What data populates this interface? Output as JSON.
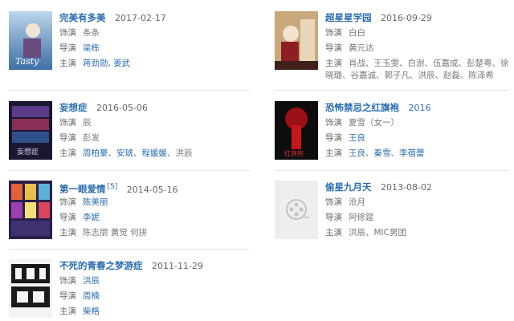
{
  "labels": {
    "role": "饰演",
    "director": "导演",
    "cast": "主演"
  },
  "movies": [
    {
      "title": "完美有多美",
      "date": "2017-02-17",
      "role": "条条",
      "director": "梁栋",
      "cast": [
        "蒋劲勋",
        "姜武"
      ]
    },
    {
      "title": "超星星学园",
      "date": "2016-09-29",
      "role": "白白",
      "director": "黄元达",
      "cast": [
        "肖战",
        "王玉雯",
        "白澍",
        "伍嘉成",
        "彭楚粤",
        "徐晓璐",
        "谷嘉诚",
        "郭子凡",
        "洪辰",
        "赵磊",
        "陈泽希"
      ]
    },
    {
      "title": "妄想症",
      "date": "2016-05-06",
      "role": "辰",
      "director": "彭发",
      "cast": [
        "周柏豪",
        "安琥",
        "程媛媛",
        "洪辰"
      ]
    },
    {
      "title": "恐怖禁忌之红旗袍",
      "date": "2016",
      "role": "夏雪（女一）",
      "director": "王良",
      "cast": [
        "王良",
        "秦雪",
        "李蓓蕾"
      ]
    },
    {
      "title": "第一眼爱情",
      "ref": "[5]",
      "date": "2014-05-16",
      "role": "陈美丽",
      "director": "李妮",
      "cast": [
        "陈志朋",
        "黄觉",
        "何拼"
      ]
    },
    {
      "title": "偷星九月天",
      "date": "2013-08-02",
      "role": "沧月",
      "director": "阿修筵",
      "cast": [
        "洪辰",
        "MIC男团"
      ]
    },
    {
      "title": "不死的青春之梦游症",
      "date": "2011-11-29",
      "role": "洪辰",
      "director": "周楠",
      "cast": [
        "柴格"
      ]
    }
  ]
}
